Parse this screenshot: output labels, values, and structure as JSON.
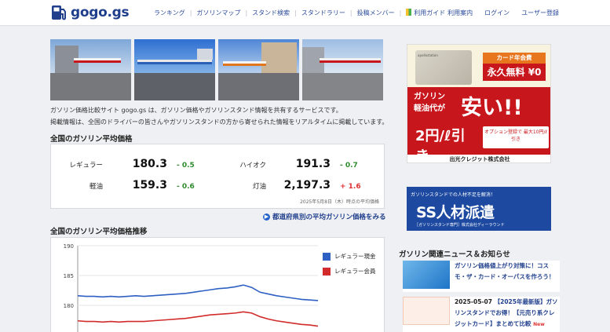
{
  "header": {
    "logo_text": "gogo.gs",
    "nav": [
      "ランキング",
      "ガソリンマップ",
      "スタンド検索",
      "スタンドラリー",
      "投稿メンバー",
      "利用ガイド"
    ],
    "nav_right": [
      "利用案内",
      "ログイン",
      "ユーザー登録"
    ]
  },
  "intro": {
    "line1": "ガソリン価格比較サイト gogo.gs は、ガソリン価格やガソリンスタンド情報を共有するサービスです。",
    "line2": "掲載情報は、全国のドライバーの皆さんやガソリンスタンドの方から寄せられた情報をリアルタイムに掲載しています。"
  },
  "prices": {
    "title": "全国のガソリン平均価格",
    "regular": {
      "label": "レギュラー",
      "value": "180.3",
      "diff": "- 0.5"
    },
    "highoctane": {
      "label": "ハイオク",
      "value": "191.3",
      "diff": "- 0.7"
    },
    "diesel": {
      "label": "軽油",
      "value": "159.3",
      "diff": "- 0.6"
    },
    "kerosene": {
      "label": "灯油",
      "value": "2,197.3",
      "diff": "+ 1.6"
    },
    "note": "2025年5月8日（木）時点の平均価格",
    "more_link": "都道府県別の平均ガソリン価格をみる"
  },
  "chart_section": {
    "title": "全国のガソリン平均価格推移"
  },
  "chart_data": {
    "type": "line",
    "title": "",
    "xlabel": "",
    "ylabel": "",
    "ylim": [
      175,
      190
    ],
    "yticks": [
      "190",
      "185",
      "180"
    ],
    "grid": true,
    "legend_position": "right",
    "x": [
      1,
      2,
      3,
      4,
      5,
      6,
      7,
      8,
      9,
      10,
      11,
      12,
      13,
      14,
      15,
      16,
      17,
      18,
      19,
      20,
      21,
      22,
      23,
      24,
      25,
      26,
      27,
      28,
      29,
      30
    ],
    "series": [
      {
        "name": "レギュラー現金",
        "color": "#2e5fc2",
        "values": [
          181.6,
          181.5,
          181.5,
          181.4,
          181.5,
          181.4,
          181.5,
          181.6,
          181.5,
          181.6,
          181.7,
          181.8,
          181.9,
          182.0,
          182.2,
          182.4,
          182.6,
          182.8,
          182.9,
          183.1,
          183.4,
          183.0,
          182.2,
          181.9,
          181.6,
          181.4,
          181.2,
          181.0,
          180.9,
          180.8
        ]
      },
      {
        "name": "レギュラー会員",
        "color": "#d22b2b",
        "values": [
          177.4,
          177.3,
          177.3,
          177.2,
          177.3,
          177.2,
          177.3,
          177.3,
          177.3,
          177.4,
          177.5,
          177.6,
          177.7,
          177.8,
          178.0,
          178.2,
          178.4,
          178.5,
          178.6,
          178.7,
          178.9,
          178.7,
          178.1,
          177.7,
          177.4,
          177.2,
          177.0,
          176.8,
          176.7,
          176.5
        ]
      }
    ]
  },
  "ads": {
    "ad1_card": "apollostation",
    "ad1_badge": "カード年会費",
    "ad1_free": "永久無料 ¥0",
    "ad1_gas1": "ガソリン",
    "ad1_gas2": "軽油代が",
    "ad1_cheap": "安い!!",
    "ad1_discount": "2円/ℓ引き",
    "ad1_option": "オプション登録で 最大10円/ℓ引き",
    "ad1_company": "出光クレジット株式会社",
    "ad2_top": "ガソリンスタンドでの人材不足を解消！",
    "ad2_main": "SS人材派遣",
    "ad2_foot": "［ガソリンスタンド専門］株式会社ディーラウンド"
  },
  "news": {
    "title": "ガソリン関連ニュース＆お知らせ",
    "items": [
      {
        "date": "",
        "text": "ガソリン価格値上がり対策に！コスモ・ザ・カード・オーパスを作ろう！",
        "new": ""
      },
      {
        "date": "2025-05-07",
        "text": "【2025年最新版】ガソリンスタンドでお得！【元売り系クレジットカード】まとめて比較",
        "new": "New"
      }
    ]
  }
}
